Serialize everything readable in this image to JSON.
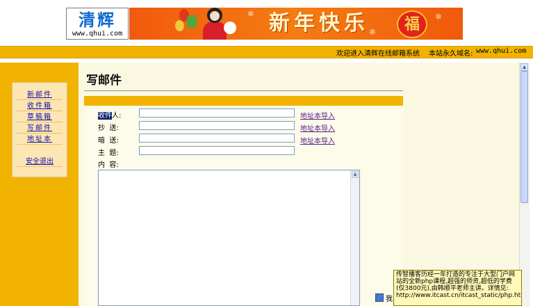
{
  "logo": {
    "title": "清辉",
    "url": "www.qhui.com"
  },
  "banner": {
    "greeting": "新年快乐",
    "fu_char": "福"
  },
  "topbar": {
    "welcome": "欢迎进入清辉在线邮箱系统",
    "domain_label": "本站永久域名:",
    "domain_url": "www.qhui.com"
  },
  "sidebar": {
    "items": [
      {
        "label": "新邮件"
      },
      {
        "label": "收件箱"
      },
      {
        "label": "草稿箱"
      },
      {
        "label": "写邮件"
      },
      {
        "label": "地址本"
      }
    ],
    "logout": "安全退出"
  },
  "compose": {
    "title": "写邮件",
    "to_label_selected": "收件",
    "to_label_rest": "人:",
    "cc_label": "抄  送:",
    "bcc_label": "暗  送:",
    "subject_label": "主  题:",
    "body_label": "内  容:",
    "import_link": "地址本导入",
    "to_value": "",
    "cc_value": "",
    "bcc_value": "",
    "subject_value": "",
    "body_value": ""
  },
  "status": {
    "text": "我"
  },
  "ad_popup": {
    "text": "传智播客历经一年打造的专注于大型门户网站的全新php课程,超强的师资,超低的学费(仅3800元),由韩顺平老师主讲。详情见: http://www.itcast.cn/itcast_static/php.htm"
  },
  "colors": {
    "accent_orange": "#f2b300",
    "content_bg": "#fbf8e2",
    "link_blue": "#1a0dab",
    "link_visited": "#551a8b"
  }
}
